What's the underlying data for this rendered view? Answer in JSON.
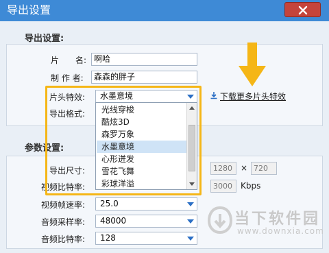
{
  "window": {
    "title": "导出设置"
  },
  "export_settings": {
    "section_title": "导出设置:",
    "title_label": "片　　名:",
    "title_value": "啊哈",
    "author_label": "制 作 者:",
    "author_value": "森森的胖子",
    "intro_effect_label": "片头特效:",
    "intro_effect_value": "水墨意境",
    "format_label": "导出格式:",
    "more_effects_link": "下载更多片头特效"
  },
  "effect_dropdown": {
    "options": [
      "光线穿梭",
      "酷炫3D",
      "森罗万象",
      "水墨意境",
      "心形迸发",
      "雪花飞舞",
      "彩球洋溢"
    ],
    "selected_index": 3
  },
  "param_settings": {
    "section_title": "参数设置:",
    "size_label": "导出尺寸:",
    "width_value": "1280",
    "times_symbol": "×",
    "height_value": "720",
    "video_bitrate_label": "视频比特率:",
    "video_bitrate_value": "3000",
    "video_bitrate_unit": "Kbps",
    "framerate_label": "视频帧速率:",
    "framerate_value": "25.0",
    "samplerate_label": "音频采样率:",
    "samplerate_value": "48000",
    "audio_bitrate_label": "音频比特率:",
    "audio_bitrate_value": "128"
  },
  "watermark": {
    "text": "当下软件园",
    "url": "www.downxia.com"
  },
  "colors": {
    "titlebar": "#3e8ad6",
    "close_button": "#c5443b",
    "highlight": "#f5b616",
    "selected_option": "#cfe3f6",
    "dropdown_arrow": "#2b6fc5"
  },
  "icons": [
    "close-icon",
    "download-icon",
    "down-arrow-annotation",
    "watermark-logo"
  ]
}
